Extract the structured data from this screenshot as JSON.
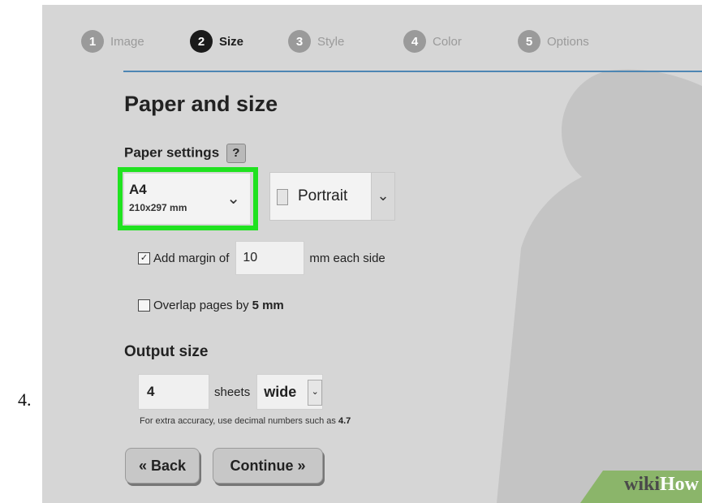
{
  "list_marker": "4.",
  "steps": [
    {
      "num": "1",
      "label": "Image"
    },
    {
      "num": "2",
      "label": "Size"
    },
    {
      "num": "3",
      "label": "Style"
    },
    {
      "num": "4",
      "label": "Color"
    },
    {
      "num": "5",
      "label": "Options"
    }
  ],
  "active_step": 2,
  "heading": "Paper and size",
  "paper_settings": {
    "label": "Paper settings",
    "help": "?",
    "paper": {
      "size": "A4",
      "dimensions": "210x297 mm"
    },
    "orientation": "Portrait"
  },
  "margin": {
    "checked": true,
    "label": "Add margin of",
    "value": "10",
    "unit": "mm each side"
  },
  "overlap": {
    "checked": false,
    "label": "Overlap pages by",
    "value": "5 mm"
  },
  "output": {
    "heading": "Output size",
    "sheets_value": "4",
    "sheets_label": "sheets",
    "direction": "wide",
    "hint_prefix": "For extra accuracy, use decimal numbers such as",
    "hint_example": "4.7"
  },
  "buttons": {
    "back": "« Back",
    "continue": "Continue »"
  },
  "watermark": {
    "part1": "wiki",
    "part2": "How"
  },
  "colors": {
    "highlight": "#20e220",
    "accent_line": "#4d86b3",
    "panel_bg": "#d6d6d6"
  }
}
